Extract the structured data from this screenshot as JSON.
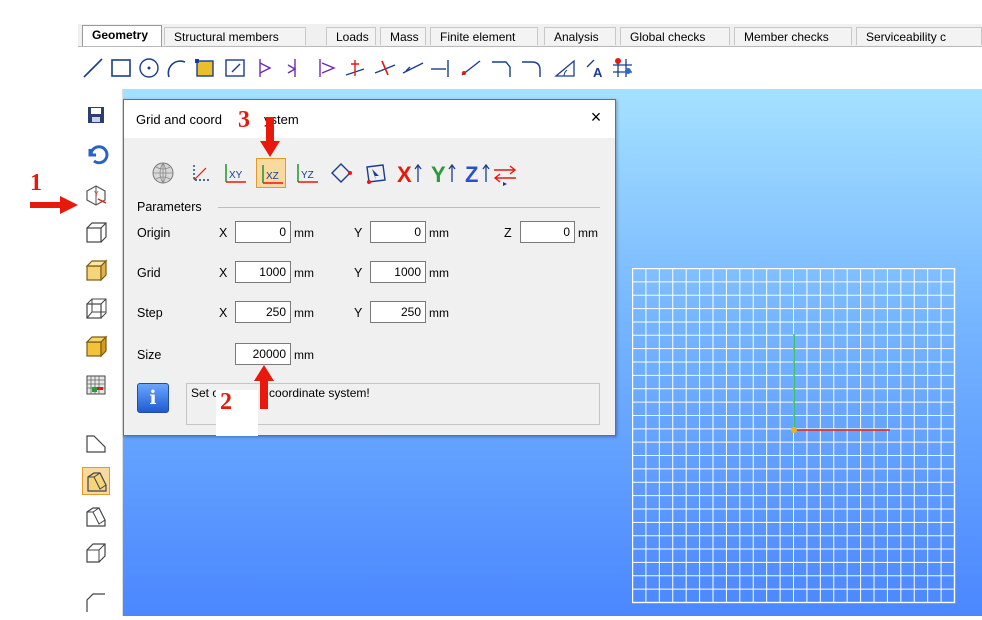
{
  "tabs": [
    "Geometry",
    "Structural members",
    "Loads",
    "Mass",
    "Finite element",
    "Analysis",
    "Global checks",
    "Member checks",
    "Serviceability c"
  ],
  "active_tab": "Geometry",
  "dialog": {
    "title": "Grid and coord",
    "title_suffix": "ystem",
    "close_glyph": "×",
    "section_label": "Parameters",
    "rows": {
      "origin": {
        "label": "Origin",
        "x": "0",
        "y": "0",
        "z": "0"
      },
      "grid": {
        "label": "Grid",
        "x": "1000",
        "y": "1000"
      },
      "step": {
        "label": "Step",
        "x": "250",
        "y": "250"
      },
      "size": {
        "label": "Size",
        "value": "20000"
      }
    },
    "axis_x": "X",
    "axis_y": "Y",
    "axis_z": "Z",
    "unit": "mm",
    "info_glyph": "i",
    "message_start": "Set o",
    "message_end": "coordinate system!",
    "icons": [
      "globe-icon",
      "origin-icon",
      "plane-xy-icon",
      "plane-xz-icon",
      "plane-yz-icon",
      "rotate-icon",
      "pick-point-icon",
      "x-axis-icon",
      "y-axis-icon",
      "z-axis-icon",
      "swap-icon"
    ],
    "axis_icon_labels": {
      "xy": "XY",
      "xz": "XZ",
      "yz": "YZ",
      "x": "X",
      "y": "Y",
      "z": "Z"
    }
  },
  "callouts": {
    "one": "1",
    "two": "2",
    "three": "3"
  },
  "colors": {
    "accent_selected": "#f8d9a0",
    "callout_red": "#e8190c",
    "viewport_top": "#a5e1ff",
    "viewport_bottom": "#4b87ff"
  }
}
